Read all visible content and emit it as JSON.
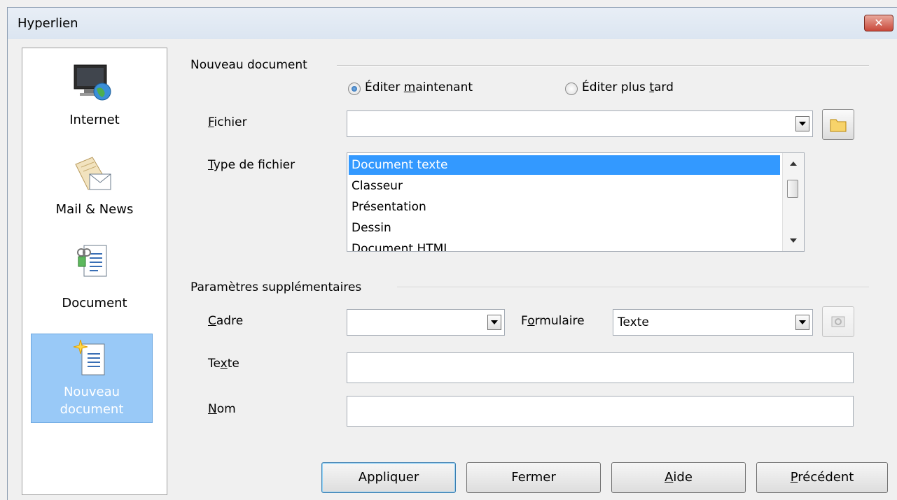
{
  "window": {
    "title": "Hyperlien",
    "close_label": "✕"
  },
  "sidebar": {
    "items": [
      {
        "label": "Internet",
        "icon": "globe-monitor-icon"
      },
      {
        "label": "Mail & News",
        "icon": "mail-icon"
      },
      {
        "label": "Document",
        "icon": "document-link-icon"
      },
      {
        "label_line1": "Nouveau",
        "label_line2": "document",
        "icon": "new-document-icon",
        "selected": true
      }
    ]
  },
  "new_document": {
    "group_label": "Nouveau document",
    "edit_now": {
      "prefix": "Éditer ",
      "mnemonic": "m",
      "suffix": "aintenant",
      "checked": true
    },
    "edit_later": {
      "prefix": "Éditer plus ",
      "mnemonic": "t",
      "suffix": "ard",
      "checked": false
    },
    "file": {
      "mnemonic": "F",
      "rest": "ichier",
      "value": ""
    },
    "file_type": {
      "mnemonic": "T",
      "rest": "ype de fichier",
      "options": [
        "Document texte",
        "Classeur",
        "Présentation",
        "Dessin",
        "Document HTML"
      ],
      "selected": "Document texte"
    }
  },
  "extra": {
    "group_label": "Paramètres supplémentaires",
    "frame": {
      "mnemonic": "C",
      "rest": "adre",
      "value": ""
    },
    "form": {
      "prefix": "F",
      "mnemonic": "o",
      "rest": "rmulaire",
      "value": "Texte"
    },
    "text": {
      "prefix": "Te",
      "mnemonic": "x",
      "rest": "te",
      "value": ""
    },
    "name": {
      "mnemonic": "N",
      "rest": "om",
      "value": ""
    }
  },
  "buttons": {
    "apply": "Appliquer",
    "close": "Fermer",
    "help": {
      "mnemonic": "A",
      "rest": "ide"
    },
    "back": {
      "mnemonic": "P",
      "rest": "récédent"
    }
  },
  "colors": {
    "selection": "#3399ff",
    "sidebar_selected": "#99c9f7"
  }
}
